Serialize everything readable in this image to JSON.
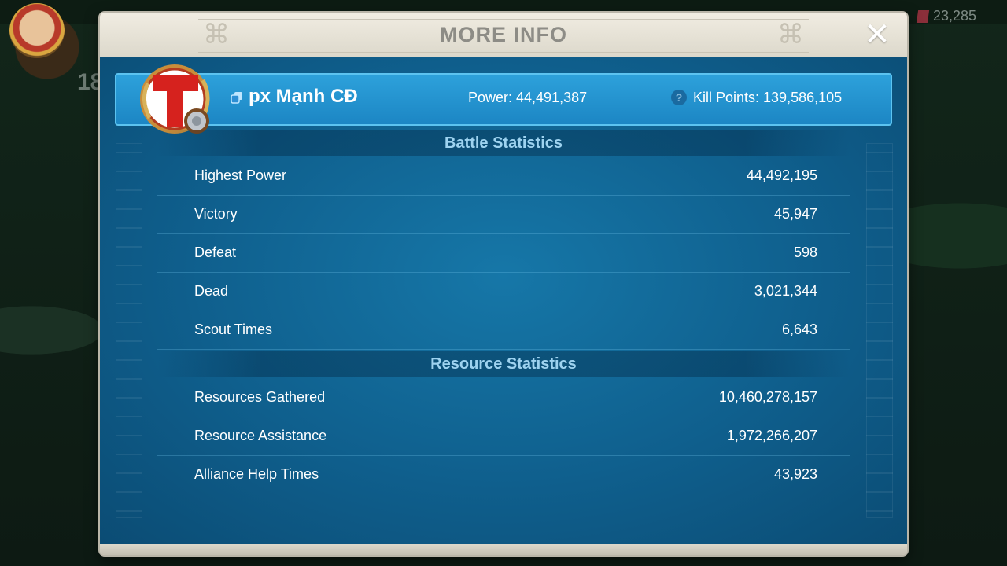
{
  "background": {
    "gems": "23,285",
    "level_fragment": "18"
  },
  "modal": {
    "title": "MORE INFO"
  },
  "player": {
    "name": "px Mạnh CĐ",
    "power": "Power: 44,491,387",
    "kill_points": "Kill Points: 139,586,105"
  },
  "battle_statistics": {
    "title": "Battle Statistics",
    "rows": [
      {
        "label": "Highest Power",
        "value": "44,492,195"
      },
      {
        "label": "Victory",
        "value": "45,947"
      },
      {
        "label": "Defeat",
        "value": "598"
      },
      {
        "label": "Dead",
        "value": "3,021,344"
      },
      {
        "label": "Scout Times",
        "value": "6,643"
      }
    ]
  },
  "resource_statistics": {
    "title": "Resource Statistics",
    "rows": [
      {
        "label": "Resources Gathered",
        "value": "10,460,278,157"
      },
      {
        "label": "Resource Assistance",
        "value": "1,972,266,207"
      },
      {
        "label": "Alliance Help Times",
        "value": "43,923"
      }
    ]
  },
  "colors": {
    "panel_blue": "#0f5f8d",
    "card_blue": "#2da1db",
    "section_text": "#9ed3f0",
    "header_beige": "#e8e4d8"
  },
  "icons": [
    "close-icon",
    "copy-icon",
    "help-icon",
    "alliance-flag-icon",
    "gem-icon"
  ]
}
